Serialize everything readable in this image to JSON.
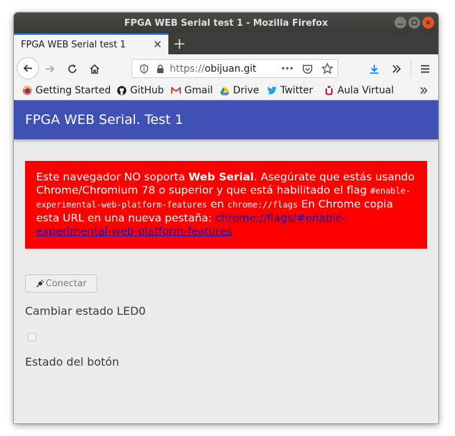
{
  "window": {
    "title": "FPGA WEB Serial test 1 - Mozilla Firefox",
    "controls": [
      "minimize-icon",
      "maximize-icon",
      "close-icon"
    ]
  },
  "tabs": [
    {
      "label": "FPGA WEB Serial test 1",
      "active": true
    }
  ],
  "navbar": {
    "url_protocol": "https://",
    "url_host": "obijuan.git",
    "icons": [
      "back-icon",
      "forward-icon",
      "reload-icon",
      "home-icon",
      "shield-icon",
      "lock-icon",
      "more-icon",
      "pocket-icon",
      "star-icon",
      "download-icon",
      "overflow-icon",
      "menu-icon"
    ]
  },
  "bookmarks": [
    {
      "label": "Getting Started",
      "icon": "firefox-icon"
    },
    {
      "label": "GitHub",
      "icon": "github-icon"
    },
    {
      "label": "Gmail",
      "icon": "gmail-icon"
    },
    {
      "label": "Drive",
      "icon": "drive-icon"
    },
    {
      "label": "Twitter",
      "icon": "twitter-icon"
    },
    {
      "label": "Aula Virtual",
      "icon": "aula-virtual-icon"
    }
  ],
  "page": {
    "appbar_title": "FPGA WEB Serial. Test 1",
    "alert": {
      "text_1": "Este navegador NO soporta ",
      "bold": "Web Serial",
      "text_2": ". Asegúrate que estás usando Chrome/Chromium 78 o superior y que está habilitado el flag ",
      "code_flag": "#enable-experimental-web-platform-features",
      "text_3": " en ",
      "code_url": "chrome://flags",
      "text_4": " En Chrome copia esta URL en una nueva pestaña: ",
      "link": "chrome://flags/#enable-experimental-web-platform-features"
    },
    "connect_button": "Conectar",
    "led_label": "Cambiar estado LED0",
    "led_checked": false,
    "button_state_label": "Estado del botón"
  },
  "colors": {
    "appbar": "#3f51b5",
    "alert_bg": "#ff0000",
    "tab_accent": "#0a84ff",
    "close_button": "#e95420"
  }
}
